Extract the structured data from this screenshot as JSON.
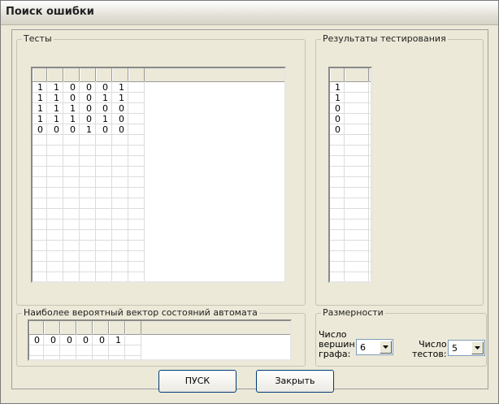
{
  "window": {
    "title": "Поиск ошибки"
  },
  "tests": {
    "legend": "Тесты",
    "rows": [
      [
        "1",
        "1",
        "0",
        "0",
        "0",
        "1"
      ],
      [
        "1",
        "1",
        "0",
        "0",
        "1",
        "1"
      ],
      [
        "1",
        "1",
        "1",
        "0",
        "0",
        "0"
      ],
      [
        "1",
        "1",
        "1",
        "0",
        "1",
        "0"
      ],
      [
        "0",
        "0",
        "0",
        "1",
        "0",
        "0"
      ]
    ]
  },
  "results": {
    "legend": "Результаты тестирования",
    "values": [
      "1",
      "1",
      "0",
      "0",
      "0"
    ]
  },
  "vector": {
    "legend": "Наиболее вероятный вектор состояний автомата",
    "values": [
      "0",
      "0",
      "0",
      "0",
      "0",
      "1"
    ]
  },
  "dimensions": {
    "legend": "Размерности",
    "vertices_label_1": "Число",
    "vertices_label_2": "вершин",
    "vertices_label_3": "графа:",
    "vertices_value": "6",
    "tests_label_1": "Число",
    "tests_label_2": "тестов:",
    "tests_value": "5"
  },
  "buttons": {
    "start": "ПУСК",
    "close": "Закрыть"
  }
}
